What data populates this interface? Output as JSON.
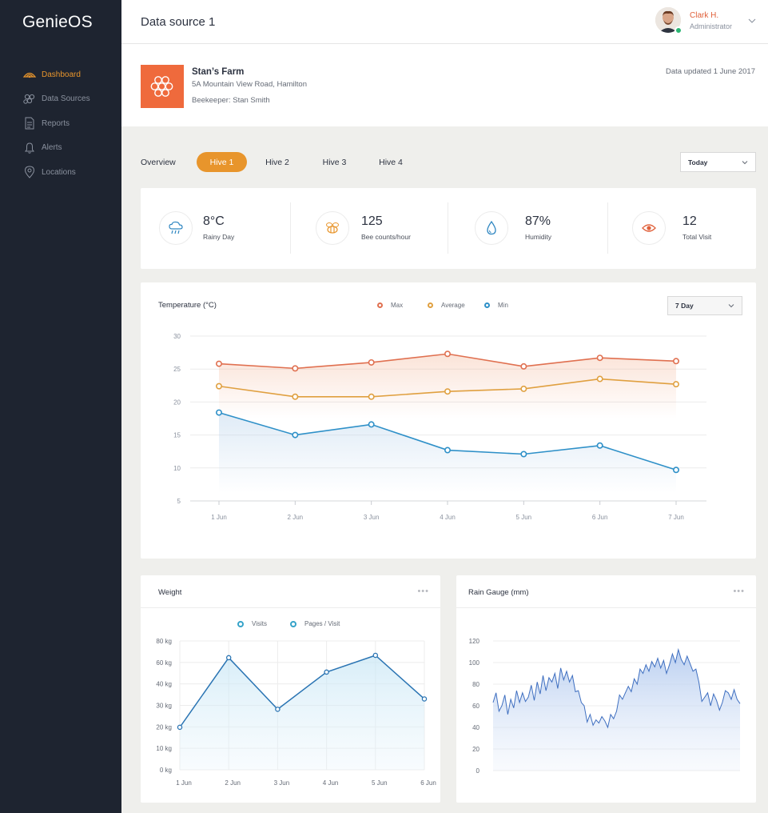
{
  "app": {
    "name": "GenieOS"
  },
  "sidebar": {
    "items": [
      {
        "label": "Dashboard",
        "icon": "dashboard-icon",
        "active": true
      },
      {
        "label": "Data Sources",
        "icon": "data-sources-icon",
        "active": false
      },
      {
        "label": "Reports",
        "icon": "reports-icon",
        "active": false
      },
      {
        "label": "Alerts",
        "icon": "bell-icon",
        "active": false
      },
      {
        "label": "Locations",
        "icon": "location-pin-icon",
        "active": false
      }
    ]
  },
  "header": {
    "title": "Data source 1",
    "user": {
      "name": "Clark H.",
      "role": "Administrator",
      "status": "online"
    }
  },
  "farm": {
    "name": "Stan’s Farm",
    "address": "5A Mountain View Road, Hamilton",
    "beekeeper": "Beekeeper: Stan Smith",
    "updated": "Data updated 1 June 2017",
    "logo_color": "#ef6a3c"
  },
  "tabs": [
    {
      "label": "Overview",
      "active": false
    },
    {
      "label": "Hive 1",
      "active": true
    },
    {
      "label": "Hive 2",
      "active": false
    },
    {
      "label": "Hive 3",
      "active": false
    },
    {
      "label": "Hive 4",
      "active": false
    }
  ],
  "period_select": {
    "value": "Today"
  },
  "stats": [
    {
      "value": "8°C",
      "label": "Rainy Day",
      "icon": "rain-cloud-icon",
      "color": "#2e86c1"
    },
    {
      "value": "125",
      "label": "Bee counts/hour",
      "icon": "bee-icon",
      "color": "#e8952c"
    },
    {
      "value": "87%",
      "label": "Humidity",
      "icon": "water-drop-icon",
      "color": "#2e86c1"
    },
    {
      "value": "12",
      "label": "Total Visit",
      "icon": "eye-icon",
      "color": "#e0603a"
    }
  ],
  "colors": {
    "accent": "#e8952c",
    "max": "#e07050",
    "average": "#e0a040",
    "min": "#2e90c8",
    "sidebar": "#1e2430"
  },
  "temperature": {
    "range_select": "7 Day",
    "chart_data": {
      "type": "line",
      "title": "Temperature (°C)",
      "categories": [
        "1 Jun",
        "2 Jun",
        "3 Jun",
        "4 Jun",
        "5 Jun",
        "6 Jun",
        "7 Jun"
      ],
      "yticks": [
        30,
        25,
        20,
        15,
        10,
        5
      ],
      "ylim": [
        5,
        30
      ],
      "grid": true,
      "series": [
        {
          "name": "Max",
          "values": [
            25.8,
            25.1,
            26.0,
            27.3,
            25.4,
            26.7,
            26.2
          ]
        },
        {
          "name": "Average",
          "values": [
            22.4,
            20.8,
            20.8,
            21.6,
            22.0,
            23.5,
            22.7
          ]
        },
        {
          "name": "Min",
          "values": [
            18.4,
            15.0,
            16.6,
            12.7,
            12.1,
            13.4,
            9.7
          ]
        }
      ]
    }
  },
  "weight": {
    "chart_data": {
      "type": "line",
      "title": "Weight",
      "legend": [
        "Visits",
        "Pages / Visit"
      ],
      "categories": [
        "1 Jun",
        "2 Jun",
        "3 Jun",
        "4 Jun",
        "5 Jun",
        "6 Jun"
      ],
      "yticks": [
        "80 kg",
        "60 kg",
        "40 kg",
        "30 kg",
        "20 kg",
        "10 kg",
        "0 kg"
      ],
      "series": [
        {
          "name": "Visits",
          "tick_index_values": [
            1.98,
            5.22,
            2.82,
            4.55,
            5.33,
            3.3
          ]
        }
      ]
    }
  },
  "rain": {
    "chart_data": {
      "type": "area",
      "title": "Rain Gauge (mm)",
      "yticks": [
        120,
        100,
        80,
        60,
        40,
        20,
        0
      ],
      "ylim": [
        0,
        120
      ],
      "values": [
        63,
        72,
        55,
        60,
        70,
        52,
        66,
        58,
        74,
        63,
        72,
        64,
        68,
        79,
        65,
        82,
        71,
        88,
        74,
        86,
        82,
        90,
        76,
        95,
        84,
        92,
        82,
        88,
        73,
        74,
        63,
        60,
        45,
        52,
        42,
        47,
        44,
        50,
        46,
        40,
        52,
        48,
        55,
        70,
        66,
        72,
        78,
        73,
        85,
        80,
        94,
        90,
        98,
        92,
        101,
        96,
        104,
        95,
        102,
        90,
        98,
        108,
        100,
        112,
        103,
        98,
        106,
        99,
        92,
        94,
        82,
        64,
        68,
        72,
        60,
        71,
        65,
        56,
        63,
        74,
        72,
        66,
        75,
        66,
        62
      ]
    }
  }
}
